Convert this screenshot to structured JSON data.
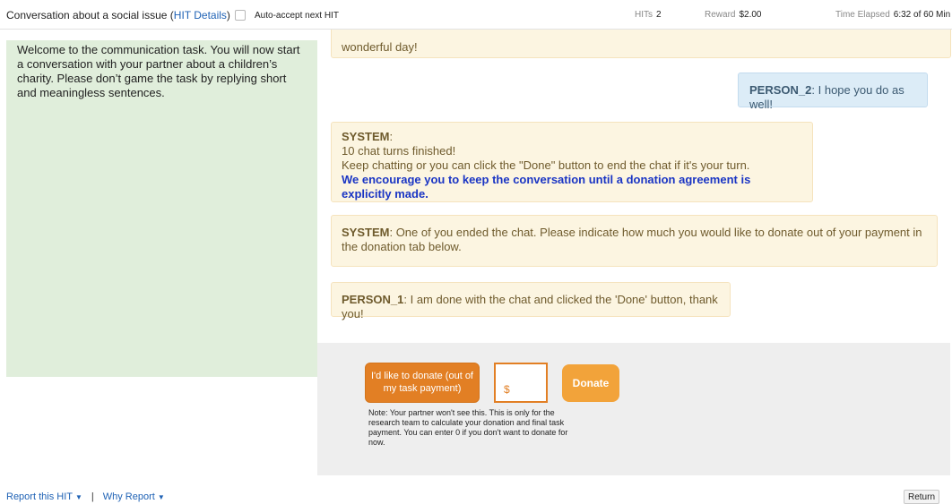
{
  "header": {
    "title": "Conversation about a social issue (",
    "hit_details": "HIT Details",
    "title_end": ")",
    "auto_accept": "Auto-accept next HIT",
    "hits_label": "HITs",
    "hits_value": "2",
    "reward_label": "Reward",
    "reward_value": "$2.00",
    "time_label": "Time Elapsed",
    "time_value": "6:32 of 60 Min"
  },
  "instructions": {
    "text": "Welcome to the communication task. You will now start a conversation with your partner about a children’s charity. Please don’t game the task by replying short and meaningless sentences."
  },
  "chat": {
    "partial_message": "wonderful day!",
    "person2": {
      "who": "PERSON_2",
      "text": "I hope you do as well!"
    },
    "system1": {
      "who": "SYSTEM",
      "colon": ":",
      "line1": "10 chat turns finished!",
      "line2": "Keep chatting or you can click the \"Done\" button to end the chat if it's your turn.",
      "line3": "We encourage you to keep the conversation until a donation agreement is explicitly made."
    },
    "system2": {
      "who": "SYSTEM",
      "text": ": One of you ended the chat. Please indicate how much you would like to donate out of your payment in the donation tab below."
    },
    "person1": {
      "who": "PERSON_1",
      "text": ": I am done with the chat and clicked the 'Done' button, thank you!"
    }
  },
  "donation": {
    "ask_label": "I'd like to donate (out of my task payment)",
    "amount_placeholder": "$",
    "donate_label": "Donate",
    "note": "Note: Your partner won't see this. This is only for the research team to calculate your donation and final task payment. You can enter 0 if you don't want to donate for now."
  },
  "footer": {
    "report": "Report this HIT",
    "separator": "|",
    "why_report": "Why Report",
    "return_label": "Return",
    "dropdown_icon": "caret-down-icon"
  }
}
